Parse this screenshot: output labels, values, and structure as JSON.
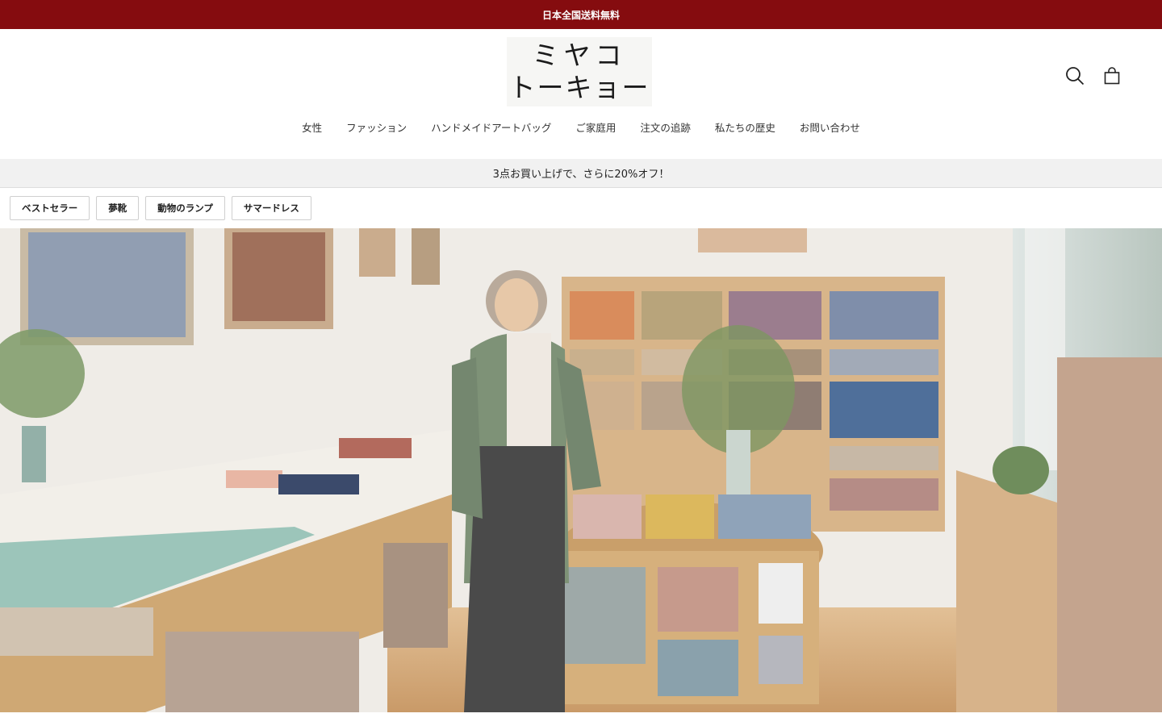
{
  "announcement": "日本全国送料無料",
  "logo": {
    "line1": "ミヤコ",
    "line2": "トーキョー"
  },
  "icons": {
    "search": "search-icon",
    "cart": "shopping-bag-icon"
  },
  "nav": [
    "女性",
    "ファッション",
    "ハンドメイドアートバッグ",
    "ご家庭用",
    "注文の追跡",
    "私たちの歴史",
    "お問い合わせ"
  ],
  "promo": "3点お買い上げで、さらに20%オフ！",
  "chips": [
    "ベストセラー",
    "夢靴",
    "動物のランプ",
    "サマードレス"
  ],
  "colors": {
    "announcement_bg": "#850c0f",
    "promo_bg": "#f1f1f1"
  }
}
